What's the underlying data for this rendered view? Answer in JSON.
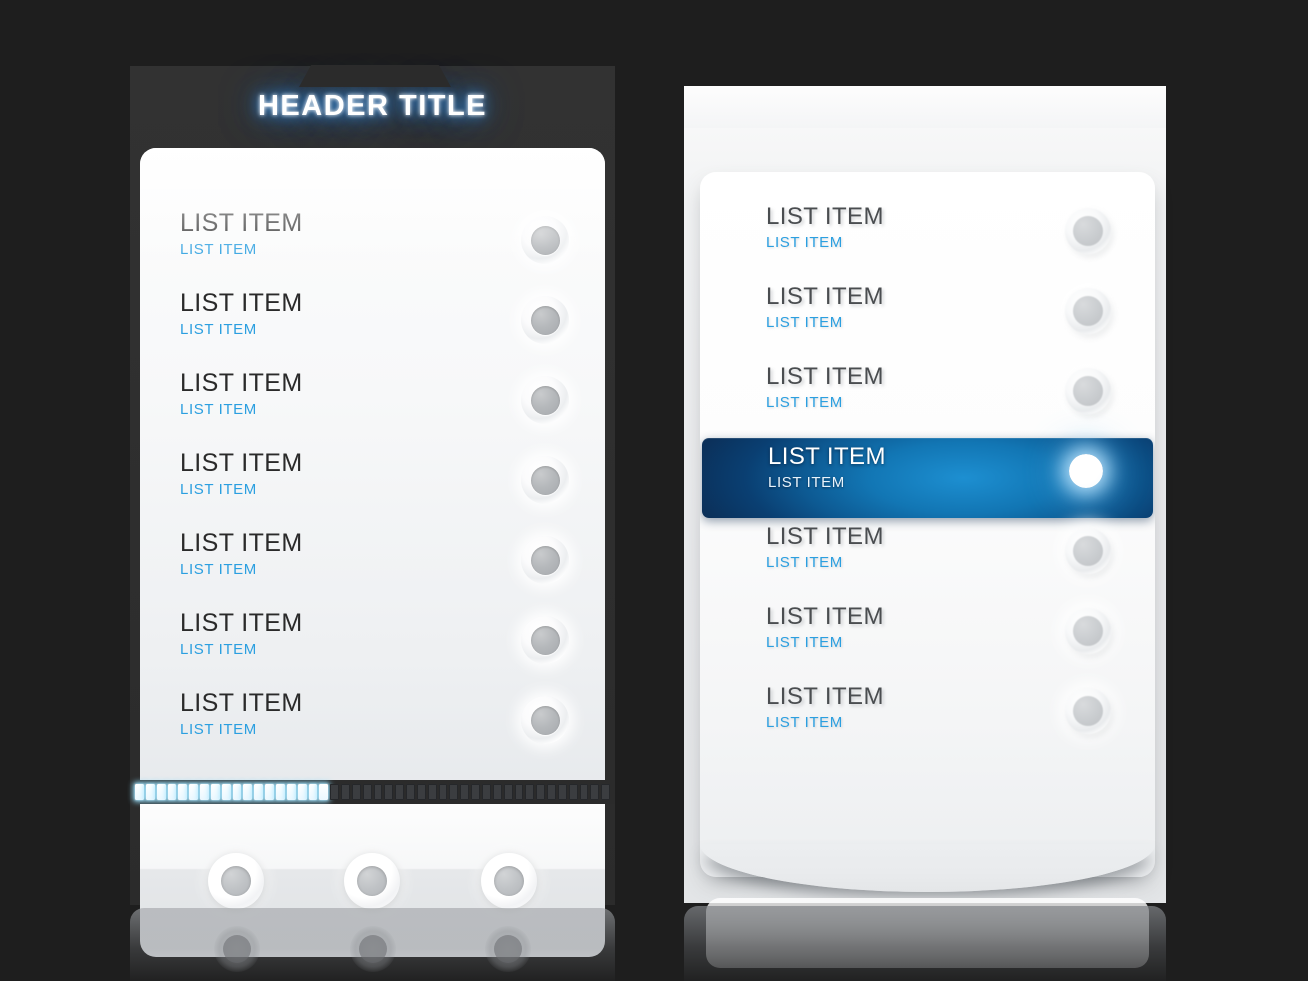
{
  "left_panel": {
    "header": {
      "title": "HEADER TITLE"
    },
    "items": [
      {
        "title": "LIST ITEM",
        "subtitle": "LIST ITEM",
        "knob": "circle-knob-icon"
      },
      {
        "title": "LIST ITEM",
        "subtitle": "LIST ITEM",
        "knob": "circle-knob-icon"
      },
      {
        "title": "LIST ITEM",
        "subtitle": "LIST ITEM",
        "knob": "circle-knob-icon"
      },
      {
        "title": "LIST ITEM",
        "subtitle": "LIST ITEM",
        "knob": "circle-knob-icon"
      },
      {
        "title": "LIST ITEM",
        "subtitle": "LIST ITEM",
        "knob": "circle-knob-icon"
      },
      {
        "title": "LIST ITEM",
        "subtitle": "LIST ITEM",
        "knob": "circle-knob-icon"
      },
      {
        "title": "LIST ITEM",
        "subtitle": "LIST ITEM",
        "knob": "circle-knob-icon"
      }
    ],
    "progress": {
      "total_segments": 44,
      "filled_segments": 18,
      "percent": 41
    },
    "footer_buttons": [
      {
        "icon": "circle-button-icon"
      },
      {
        "icon": "circle-button-icon"
      },
      {
        "icon": "circle-button-icon"
      }
    ]
  },
  "right_panel": {
    "items": [
      {
        "title": "LIST ITEM",
        "subtitle": "LIST ITEM",
        "selected": false,
        "knob": "circle-knob-icon"
      },
      {
        "title": "LIST ITEM",
        "subtitle": "LIST ITEM",
        "selected": false,
        "knob": "circle-knob-icon"
      },
      {
        "title": "LIST ITEM",
        "subtitle": "LIST ITEM",
        "selected": false,
        "knob": "circle-knob-icon"
      },
      {
        "title": "LIST ITEM",
        "subtitle": "LIST ITEM",
        "selected": true,
        "knob": "selected-indicator-icon"
      },
      {
        "title": "LIST ITEM",
        "subtitle": "LIST ITEM",
        "selected": false,
        "knob": "circle-knob-icon"
      },
      {
        "title": "LIST ITEM",
        "subtitle": "LIST ITEM",
        "selected": false,
        "knob": "circle-knob-icon"
      },
      {
        "title": "LIST ITEM",
        "subtitle": "LIST ITEM",
        "selected": false,
        "knob": "circle-knob-icon"
      }
    ]
  },
  "colors": {
    "background": "#1e1e1e",
    "left_frame": "#2e2e2e",
    "accent_blue": "#2b9fe0",
    "title_glow": "#3b8fe0",
    "selected_row_core": "#1d8fd1",
    "selected_row_edge": "#0b2f58",
    "progress_fill": "#eaf8ff",
    "progress_empty": "#3b3d40",
    "title_text": "#ffffff",
    "item_title_left": "#2a2a2a",
    "item_title_right": "#4a4d50"
  }
}
